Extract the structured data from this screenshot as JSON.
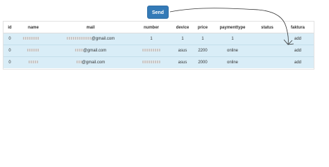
{
  "send_button": {
    "label": "Send"
  },
  "table": {
    "headers": [
      "id",
      "name",
      "mail",
      "number",
      "device",
      "price",
      "paymenttype",
      "status",
      "faktura"
    ],
    "rows": [
      {
        "id": "0",
        "name": "",
        "mail": "@gmail.com",
        "number": "1",
        "device": "1",
        "price": "1",
        "paymenttype": "1",
        "status": "",
        "faktura": "add"
      },
      {
        "id": "0",
        "name": "",
        "mail": "@gmail.com",
        "number": "",
        "device": "asus",
        "price": "2200",
        "paymenttype": "online",
        "status": "",
        "faktura": "add"
      },
      {
        "id": "0",
        "name": "",
        "mail": "@gmail.com",
        "number": "",
        "device": "asus",
        "price": "2000",
        "paymenttype": "online",
        "status": "",
        "faktura": "add"
      }
    ]
  },
  "colors": {
    "button_bg": "#337ab7",
    "row_highlight": "#d9edf7",
    "annotation_stroke": "#333333"
  },
  "annotation": {
    "type": "hand-drawn-arrow",
    "from": "send-button",
    "to": "faktura-add"
  }
}
